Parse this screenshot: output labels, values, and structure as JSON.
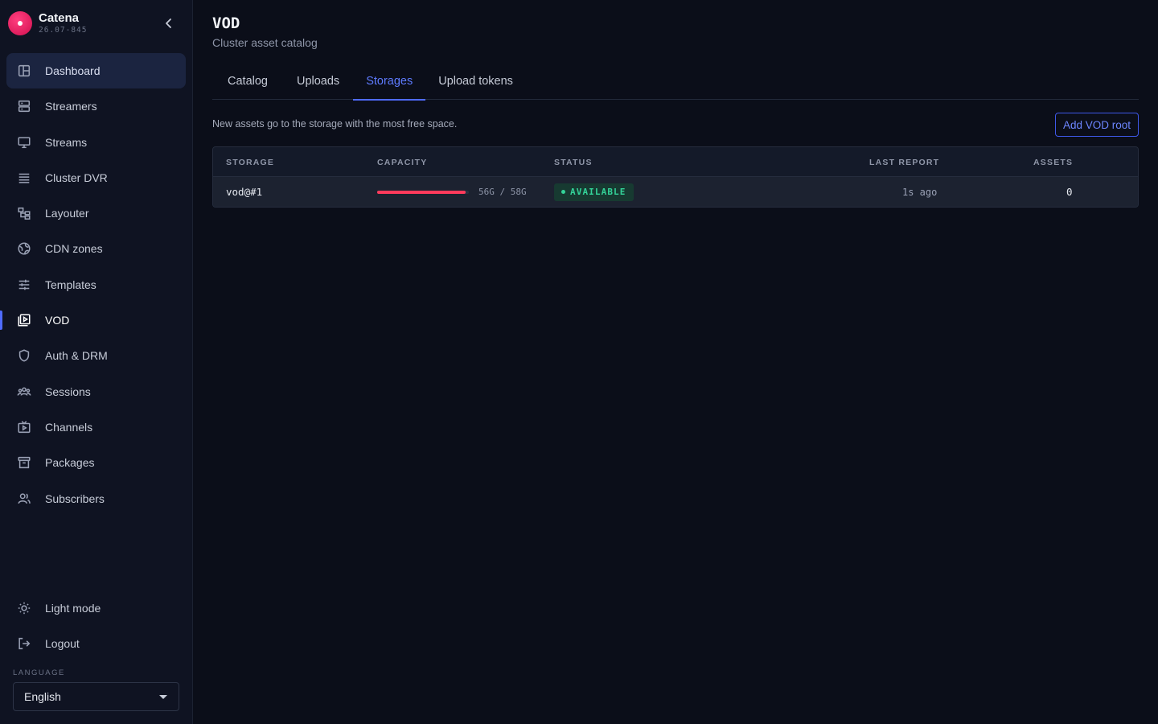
{
  "app": {
    "name": "Catena",
    "version": "26.07-845"
  },
  "sidebar": {
    "items": [
      {
        "label": "Dashboard",
        "icon": "dashboard-icon"
      },
      {
        "label": "Streamers",
        "icon": "server-icon"
      },
      {
        "label": "Streams",
        "icon": "monitor-icon"
      },
      {
        "label": "Cluster DVR",
        "icon": "list-icon"
      },
      {
        "label": "Layouter",
        "icon": "layout-icon"
      },
      {
        "label": "CDN zones",
        "icon": "globe-icon"
      },
      {
        "label": "Templates",
        "icon": "sliders-icon"
      },
      {
        "label": "VOD",
        "icon": "video-library-icon"
      },
      {
        "label": "Auth & DRM",
        "icon": "shield-icon"
      },
      {
        "label": "Sessions",
        "icon": "users-group-icon"
      },
      {
        "label": "Channels",
        "icon": "tv-icon"
      },
      {
        "label": "Packages",
        "icon": "archive-icon"
      },
      {
        "label": "Subscribers",
        "icon": "users-icon"
      }
    ],
    "active_item": "VOD",
    "hovered_item": "Dashboard",
    "bottom": {
      "theme_toggle": "Light mode",
      "logout": "Logout"
    },
    "language": {
      "label": "LANGUAGE",
      "selected": "English"
    }
  },
  "page": {
    "title": "VOD",
    "subtitle": "Cluster asset catalog",
    "tabs": [
      {
        "label": "Catalog"
      },
      {
        "label": "Uploads"
      },
      {
        "label": "Storages"
      },
      {
        "label": "Upload tokens"
      }
    ],
    "active_tab": "Storages",
    "hint": "New assets go to the storage with the most free space.",
    "add_button": "Add VOD root"
  },
  "table": {
    "columns": [
      "STORAGE",
      "CAPACITY",
      "STATUS",
      "LAST REPORT",
      "ASSETS"
    ],
    "rows": [
      {
        "storage": "vod@#1",
        "capacity_text": "56G / 58G",
        "capacity_used_fraction": 0.966,
        "status": "AVAILABLE",
        "last_report": "1s ago",
        "assets": "0"
      }
    ]
  },
  "colors": {
    "accent": "#4f6bff",
    "status_available": "#34d399",
    "capacity_fill": "#ff3b5c",
    "brand": "#e0155a"
  }
}
